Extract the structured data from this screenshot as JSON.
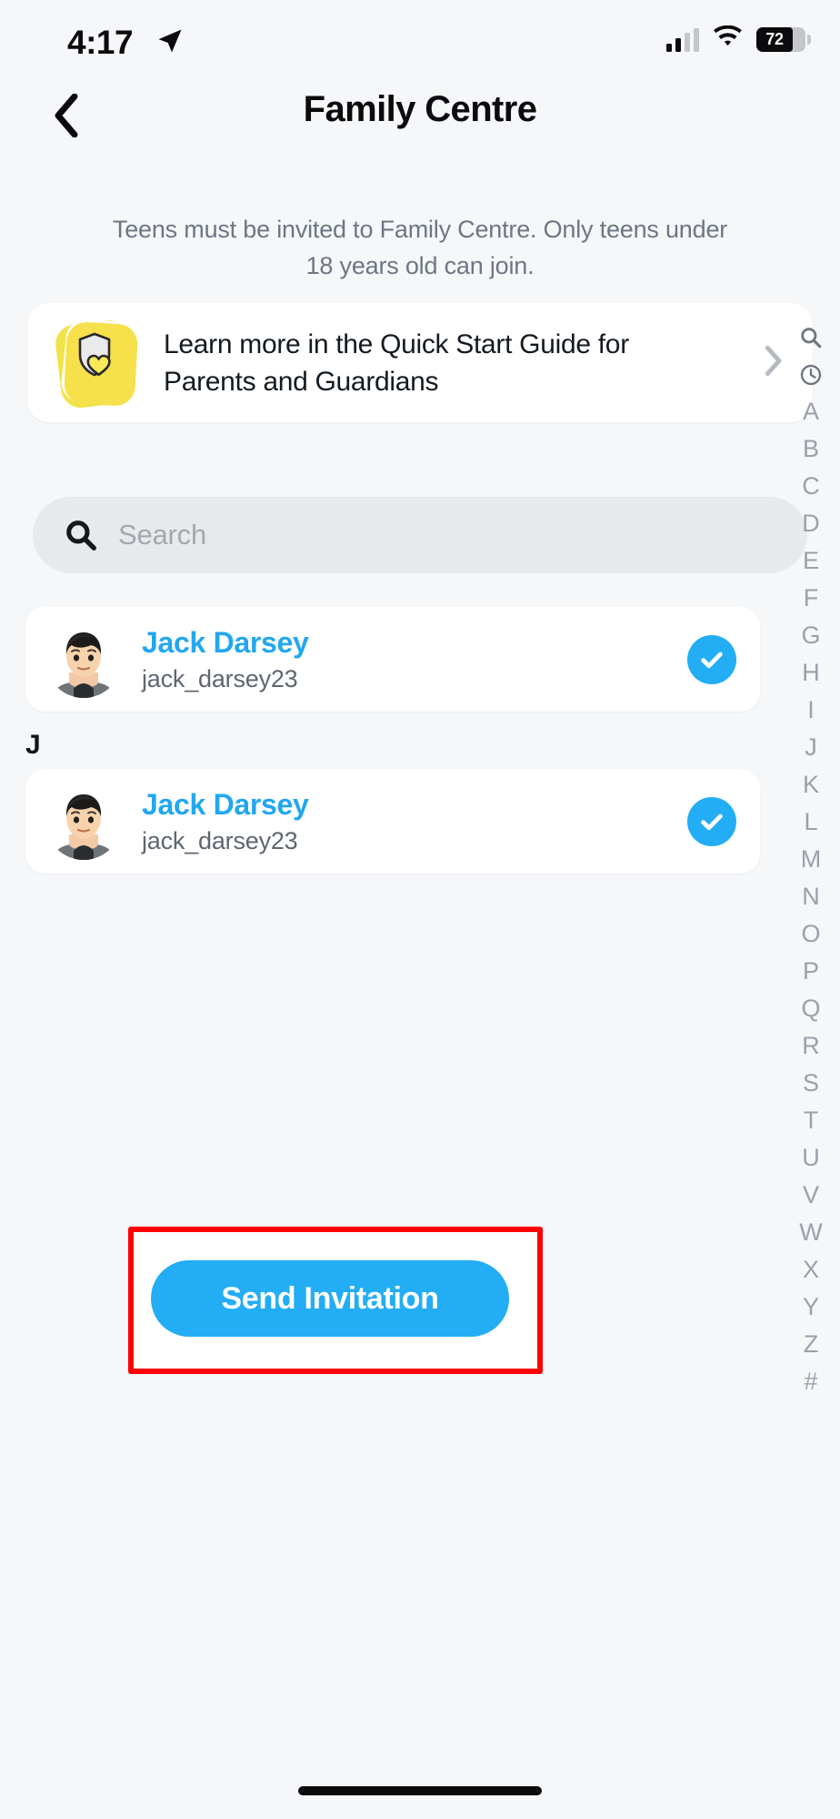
{
  "statusbar": {
    "time": "4:17",
    "location_icon": "location-arrow-icon",
    "signal_icon": "cellular-signal-icon",
    "wifi_icon": "wifi-icon",
    "battery_percent": "72",
    "battery_icon": "battery-icon"
  },
  "nav": {
    "back_icon": "chevron-left-icon",
    "title": "Family Centre"
  },
  "subtitle": "Teens must be invited to Family Centre. Only teens under 18 years old can join.",
  "quick_start": {
    "icon": "shield-heart-icon",
    "text": "Learn more in the Quick Start Guide for Parents and Guardians",
    "chevron_icon": "chevron-right-icon"
  },
  "search": {
    "icon": "search-icon",
    "value": "",
    "placeholder": "Search"
  },
  "contacts": [
    {
      "name": "Jack Darsey",
      "username": "jack_darsey23",
      "selected": true,
      "check_icon": "check-circle-icon",
      "avatar": "bitmoji-avatar"
    },
    {
      "name": "Jack Darsey",
      "username": "jack_darsey23",
      "selected": true,
      "check_icon": "check-circle-icon",
      "avatar": "bitmoji-avatar"
    }
  ],
  "section_letter": "J",
  "alpha_index": [
    "search-icon",
    "recent-clock-icon",
    "A",
    "B",
    "C",
    "D",
    "E",
    "F",
    "G",
    "H",
    "I",
    "J",
    "K",
    "L",
    "M",
    "N",
    "O",
    "P",
    "Q",
    "R",
    "S",
    "T",
    "U",
    "V",
    "W",
    "X",
    "Y",
    "Z",
    "#"
  ],
  "cta": {
    "label": "Send Invitation"
  },
  "colors": {
    "accent_blue": "#22ADF5",
    "name_blue": "#22a7f0",
    "page_bg": "#f5f7f9",
    "card_bg": "#ffffff",
    "search_bg": "#e7e9ec",
    "muted_text": "#6e7683",
    "index_text": "#9aa1aa",
    "highlight_red": "#ff0000",
    "icon_yellow": "#f6e04b"
  }
}
